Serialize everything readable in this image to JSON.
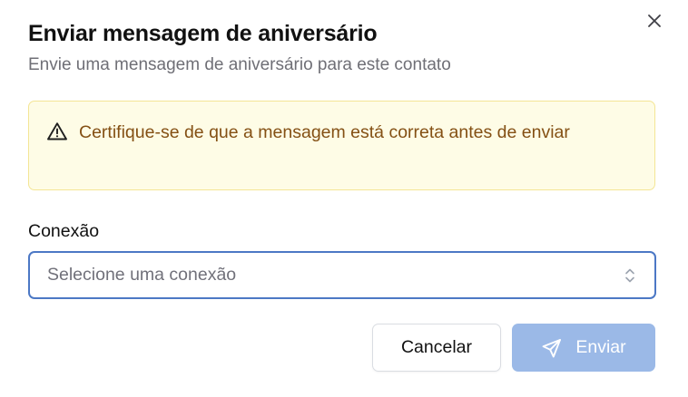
{
  "dialog": {
    "title": "Enviar mensagem de aniversário",
    "subtitle": "Envie uma mensagem de aniversário para este contato",
    "close_icon": "x-icon"
  },
  "alert": {
    "icon": "warning-triangle-icon",
    "text": "Certifique-se de que a mensagem está correta antes de enviar",
    "background": "#fefce6",
    "border": "#f4e595",
    "text_color": "#845014"
  },
  "connection": {
    "label": "Conexão",
    "placeholder": "Selecione uma conexão",
    "icon": "chevron-up-down-icon",
    "focus_border": "#4c78c5"
  },
  "actions": {
    "cancel_label": "Cancelar",
    "send_label": "Enviar",
    "send_icon": "send-icon",
    "send_background": "#9bb9e7",
    "send_disabled": true
  }
}
